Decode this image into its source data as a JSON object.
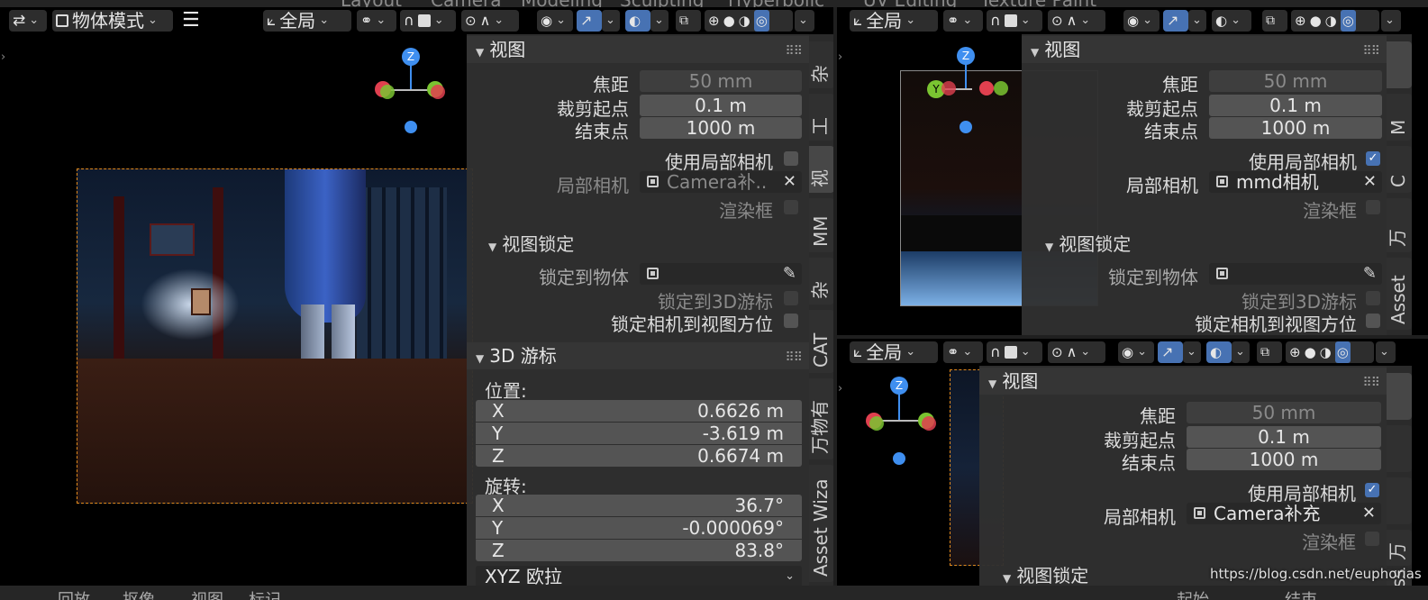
{
  "top_menu": [
    "Layout",
    "Camera",
    "Modeling",
    "Sculpting",
    "Hyperbolic",
    "UV Editing",
    "Texture Paint"
  ],
  "left_viewport": {
    "header": {
      "mode": "物体模式",
      "orientation": "全局"
    },
    "view_panel": {
      "title": "视图",
      "focal_label": "焦距",
      "focal_value": "50 mm",
      "clip_start_label": "裁剪起点",
      "clip_start_value": "0.1 m",
      "clip_end_label": "结束点",
      "clip_end_value": "1000 m",
      "use_local_camera_label": "使用局部相机",
      "use_local_camera": false,
      "local_camera_label": "局部相机",
      "local_camera_value": "Camera补..",
      "render_border_label": "渲染框"
    },
    "view_lock": {
      "title": "视图锁定",
      "lock_object_label": "锁定到物体",
      "lock_cursor_label": "锁定到3D游标",
      "lock_camera_label": "锁定相机到视图方位"
    },
    "cursor_panel": {
      "title": "3D 游标",
      "location_label": "位置:",
      "location": [
        {
          "axis": "X",
          "value": "0.6626 m"
        },
        {
          "axis": "Y",
          "value": "-3.619 m"
        },
        {
          "axis": "Z",
          "value": "0.6674 m"
        }
      ],
      "rotation_label": "旋转:",
      "rotation": [
        {
          "axis": "X",
          "value": "36.7°"
        },
        {
          "axis": "Y",
          "value": "-0.000069°"
        },
        {
          "axis": "Z",
          "value": "83.8°"
        }
      ],
      "rotation_mode": "XYZ 欧拉"
    },
    "tabs": [
      "杂",
      "工",
      "视",
      "MM",
      "杂",
      "CAT",
      "万物有",
      "Asset Wiza"
    ]
  },
  "right_top_viewport": {
    "header": {
      "orientation": "全局"
    },
    "view_panel": {
      "title": "视图",
      "focal_label": "焦距",
      "focal_value": "50 mm",
      "clip_start_label": "裁剪起点",
      "clip_start_value": "0.1 m",
      "clip_end_label": "结束点",
      "clip_end_value": "1000 m",
      "use_local_camera_label": "使用局部相机",
      "use_local_camera": true,
      "local_camera_label": "局部相机",
      "local_camera_value": "mmd相机",
      "render_border_label": "渲染框"
    },
    "view_lock": {
      "title": "视图锁定",
      "lock_object_label": "锁定到物体",
      "lock_cursor_label": "锁定到3D游标",
      "lock_camera_label": "锁定相机到视图方位"
    },
    "tabs": [
      "M",
      "C",
      "万",
      "Asset"
    ]
  },
  "right_bottom_viewport": {
    "header": {
      "orientation": "全局"
    },
    "view_panel": {
      "title": "视图",
      "focal_label": "焦距",
      "focal_value": "50 mm",
      "clip_start_label": "裁剪起点",
      "clip_start_value": "0.1 m",
      "clip_end_label": "结束点",
      "clip_end_value": "1000 m",
      "use_local_camera_label": "使用局部相机",
      "use_local_camera": true,
      "local_camera_label": "局部相机",
      "local_camera_value": "Camera补充",
      "render_border_label": "渲染框"
    },
    "view_lock": {
      "title": "视图锁定"
    },
    "tabs": [
      "万",
      "Ass"
    ]
  },
  "gizmo": {
    "z": "Z",
    "y": "Y"
  },
  "status_bar": [
    "回放",
    "抠像",
    "视图",
    "标记",
    "起始",
    "结束"
  ],
  "watermark": "https://blog.csdn.net/euphorias",
  "colors": {
    "accent": "#4772b3",
    "camera_frame": "#e08a1e",
    "axis_x": "#e0404f",
    "axis_y": "#7ac431",
    "axis_z": "#3f8ff0"
  }
}
